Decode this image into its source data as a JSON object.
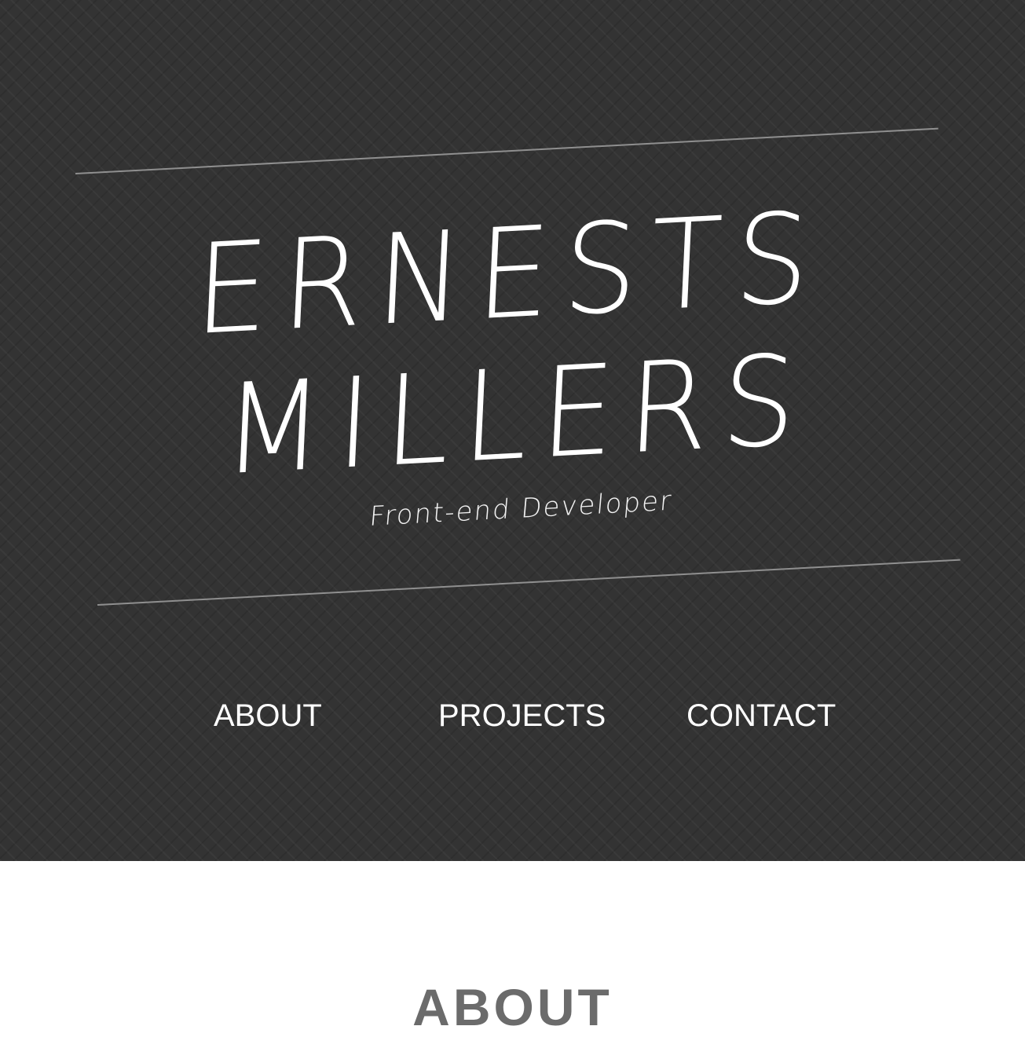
{
  "header": {
    "name_first": "ERNESTS",
    "name_last": "MILLERS",
    "subtitle": "Front-end Developer"
  },
  "nav": {
    "items": [
      {
        "label": "ABOUT"
      },
      {
        "label": "PROJECTS"
      },
      {
        "label": "CONTACT"
      }
    ]
  },
  "about": {
    "title": "ABOUT"
  },
  "colors": {
    "hero_background": "#333333",
    "rule": "#8f8f8f",
    "hero_text": "#ffffff",
    "section_title": "#6b6b6b",
    "page_background": "#ffffff"
  }
}
